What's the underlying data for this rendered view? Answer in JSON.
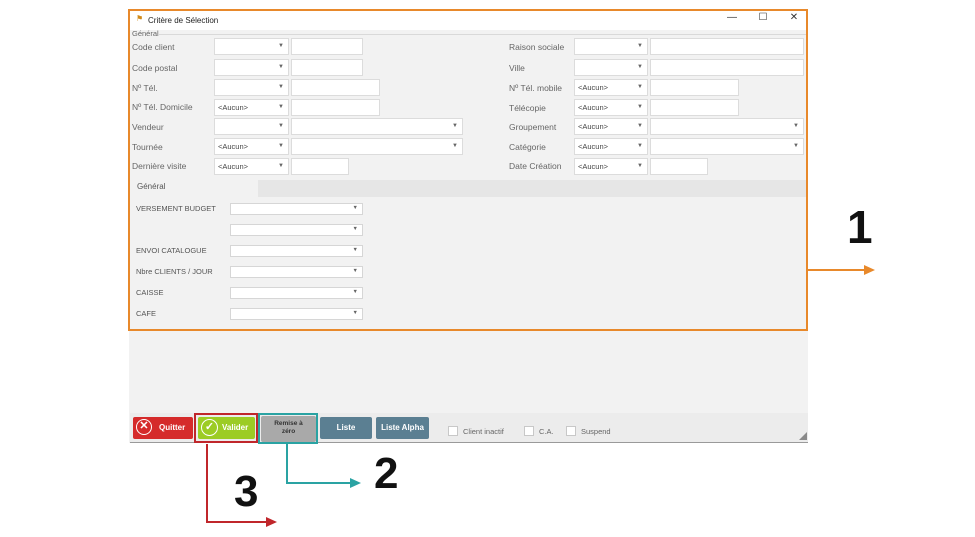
{
  "window": {
    "title": "Critère de Sélection",
    "minimize_icon": "—",
    "maximize_icon": "☐",
    "close_icon": "✕"
  },
  "section": {
    "legend": "Général"
  },
  "left_fields": [
    {
      "label": "Code client",
      "select": "",
      "input": ""
    },
    {
      "label": "Code postal",
      "select": "",
      "input": ""
    },
    {
      "label": "Nº Tél.",
      "select": "",
      "input": ""
    },
    {
      "label": "Nº Tél. Domicile",
      "select": "<Aucun>",
      "input": ""
    },
    {
      "label": "Vendeur",
      "select": "",
      "input": ""
    },
    {
      "label": "Tournée",
      "select": "<Aucun>",
      "input": ""
    },
    {
      "label": "Dernière visite",
      "select": "<Aucun>",
      "input": ""
    }
  ],
  "right_fields": [
    {
      "label": "Raison sociale",
      "select": "",
      "input": ""
    },
    {
      "label": "Ville",
      "select": "",
      "input": ""
    },
    {
      "label": "Nº Tél. mobile",
      "select": "<Aucun>",
      "input": ""
    },
    {
      "label": "Télécopie",
      "select": "<Aucun>",
      "input": ""
    },
    {
      "label": "Groupement",
      "select": "<Aucun>",
      "input": ""
    },
    {
      "label": "Catégorie",
      "select": "<Aucun>",
      "input": ""
    },
    {
      "label": "Date Création",
      "select": "<Aucun>",
      "input": ""
    }
  ],
  "tab": {
    "label": "Général"
  },
  "tab_fields": [
    {
      "label": "VERSEMENT BUDGET",
      "value": ""
    },
    {
      "label": "",
      "value": ""
    },
    {
      "label": "ENVOI CATALOGUE",
      "value": ""
    },
    {
      "label": "Nbre CLIENTS / JOUR",
      "value": ""
    },
    {
      "label": "CAISSE",
      "value": ""
    },
    {
      "label": "CAFE",
      "value": ""
    }
  ],
  "buttons": {
    "quitter": "Quitter",
    "valider": "Valider",
    "remise_line1": "Remise à",
    "remise_line2": "zéro",
    "liste": "Liste",
    "liste_alpha": "Liste Alpha"
  },
  "checkboxes": [
    {
      "label": "Client inactif",
      "checked": false
    },
    {
      "label": "C.A.",
      "checked": false
    },
    {
      "label": "Suspend",
      "checked": false
    }
  ],
  "callouts": [
    {
      "number": "1",
      "color": "#e8892b"
    },
    {
      "number": "2",
      "color": "#2aa3a3"
    },
    {
      "number": "3",
      "color": "#c0262b"
    }
  ],
  "colors": {
    "orange": "#e8892b",
    "teal": "#2aa3a3",
    "red": "#c0262b",
    "quitter_bg": "#d52b2b",
    "valider_bg": "#9ccc24",
    "liste_bg": "#5b7f92"
  }
}
